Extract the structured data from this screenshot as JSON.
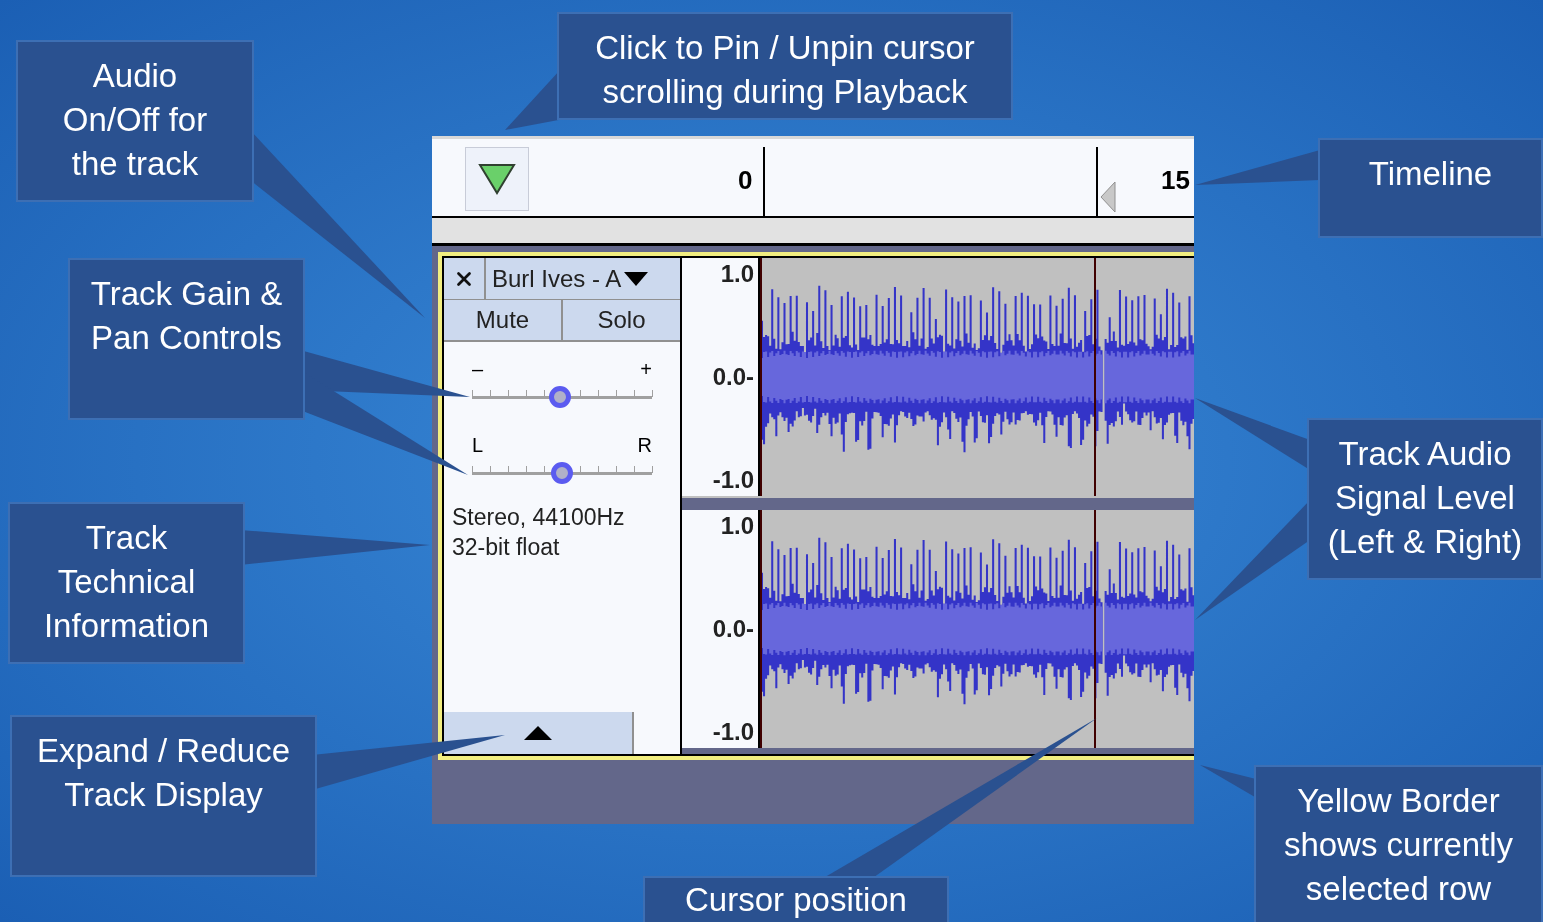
{
  "callouts": [
    {
      "lines": [
        "Audio",
        "On/Off for",
        "the track"
      ]
    },
    {
      "lines": [
        "Click to Pin / Unpin cursor",
        "scrolling during Playback"
      ]
    },
    {
      "lines": [
        "Timeline"
      ]
    },
    {
      "lines": [
        "Track Gain &",
        "Pan Controls"
      ]
    },
    {
      "lines": [
        "Track Audio",
        "Signal Level",
        "(Left & Right)"
      ]
    },
    {
      "lines": [
        "Track",
        "Technical",
        "Information"
      ]
    },
    {
      "lines": [
        "Expand / Reduce",
        "Track Display"
      ]
    },
    {
      "lines": [
        "Cursor position"
      ]
    },
    {
      "lines": [
        "Yellow Border",
        "shows currently",
        "selected row"
      ]
    }
  ],
  "timeline": {
    "labels": [
      "0",
      "15"
    ]
  },
  "track": {
    "selected": true,
    "name": "Burl Ives - A",
    "buttons": [
      "Mute",
      "Solo"
    ],
    "gain": {
      "min_label": "–",
      "max_label": "+",
      "level": 0.49
    },
    "pan": {
      "min_label": "L",
      "max_label": "R",
      "level": 0.5
    },
    "info": [
      "Stereo, 44100Hz",
      "32-bit float"
    ],
    "channels": [
      {
        "scale": [
          "1.0",
          "0.0-",
          "-1.0"
        ]
      },
      {
        "scale": [
          "1.0",
          "0.0-",
          "-1.0"
        ]
      }
    ]
  }
}
